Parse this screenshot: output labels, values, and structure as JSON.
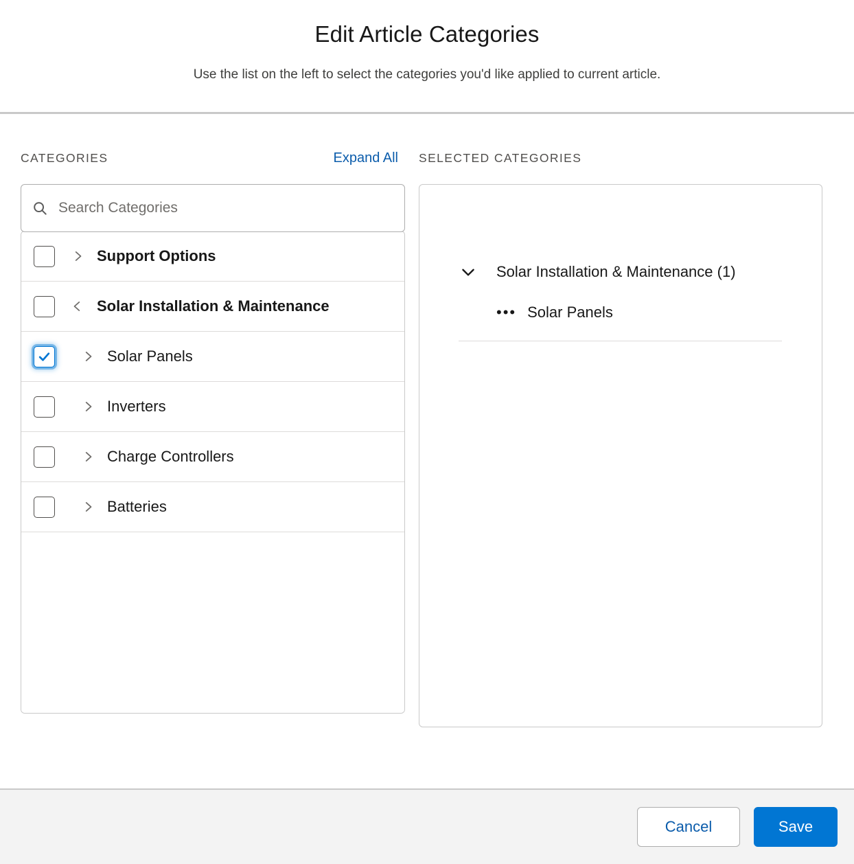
{
  "header": {
    "title": "Edit Article Categories",
    "subtitle": "Use the list on the left to select the categories you'd like applied to current article."
  },
  "left_panel": {
    "section_label": "CATEGORIES",
    "expand_all_label": "Expand All",
    "search": {
      "placeholder": "Search Categories",
      "value": "",
      "icon": "search-icon"
    },
    "tree_rows": [
      {
        "label": "Support Options",
        "checked": false,
        "chevron": "chevron-right-icon",
        "level": 0,
        "bold": true
      },
      {
        "label": "Solar Installation & Maintenance",
        "checked": false,
        "chevron": "chevron-left-icon",
        "level": 0,
        "bold": true
      },
      {
        "label": "Solar Panels",
        "checked": true,
        "chevron": "chevron-right-icon",
        "level": 1,
        "bold": false
      },
      {
        "label": "Inverters",
        "checked": false,
        "chevron": "chevron-right-icon",
        "level": 1,
        "bold": false
      },
      {
        "label": "Charge Controllers",
        "checked": false,
        "chevron": "chevron-right-icon",
        "level": 1,
        "bold": false
      },
      {
        "label": "Batteries",
        "checked": false,
        "chevron": "chevron-right-icon",
        "level": 1,
        "bold": false
      }
    ]
  },
  "right_panel": {
    "section_label": "SELECTED CATEGORIES",
    "selected": {
      "parent_label": "Solar Installation & Maintenance (1)",
      "parent_chevron": "chevron-down-icon",
      "child_bullet": "•••",
      "child_label": "Solar Panels"
    }
  },
  "footer": {
    "cancel_label": "Cancel",
    "save_label": "Save"
  },
  "colors": {
    "brand_blue": "#0176d3",
    "link_blue": "#0b5cab",
    "footer_bg": "#f3f3f3",
    "border_gray": "#c9c9c9",
    "text": "#181818"
  }
}
